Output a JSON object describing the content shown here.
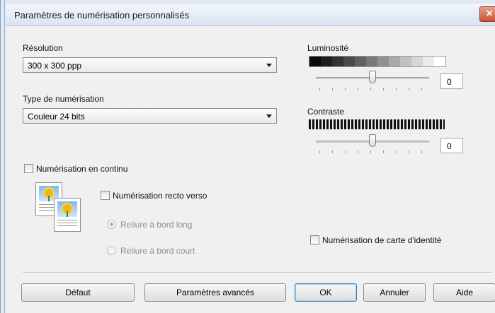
{
  "window": {
    "title": "Paramètres de numérisation personnalisés",
    "close_symbol": "✕"
  },
  "resolution": {
    "label": "Résolution",
    "selected": "300 x 300 ppp"
  },
  "scan_type": {
    "label": "Type de numérisation",
    "selected": "Couleur 24 bits"
  },
  "brightness": {
    "label": "Luminosité",
    "value": "0",
    "scale_colors": [
      "#0a0a0a",
      "#1e1e1e",
      "#333333",
      "#4a4a4a",
      "#616161",
      "#797979",
      "#919191",
      "#a9a9a9",
      "#c1c1c1",
      "#d6d6d6",
      "#ebebeb",
      "#ffffff"
    ]
  },
  "contrast": {
    "label": "Contraste",
    "value": "0"
  },
  "continuous_scan": {
    "label": "Numérisation en continu",
    "checked": false
  },
  "duplex": {
    "label": "Numérisation recto verso",
    "checked": false,
    "binding_options": [
      {
        "label": "Reliure à bord long",
        "selected": true,
        "enabled": false
      },
      {
        "label": "Reliure à bord court",
        "selected": false,
        "enabled": false
      }
    ]
  },
  "id_card_scan": {
    "label": "Numérisation de carte d'identité",
    "checked": false
  },
  "buttons": {
    "default": "Défaut",
    "advanced": "Paramètres avancés",
    "ok": "OK",
    "cancel": "Annuler",
    "help": "Aide"
  },
  "colors": {
    "title_bar": "#dbe6f2",
    "close_button": "#c6522f",
    "dialog_bg": "#f0f0f0"
  },
  "icons": [
    "document-duplex-icon",
    "chevron-down-icon",
    "close-icon"
  ]
}
